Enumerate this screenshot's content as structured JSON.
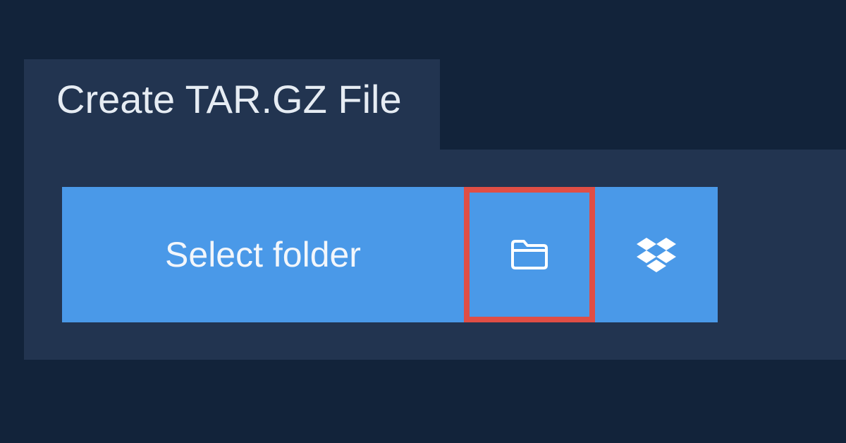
{
  "colors": {
    "page_background": "#12233a",
    "panel_background": "#223450",
    "button_background": "#4a99e8",
    "highlight_border": "#e04e45",
    "text": "#e6ecf3"
  },
  "panel": {
    "title": "Create TAR.GZ File"
  },
  "buttons": {
    "select_folder_label": "Select folder",
    "folder_icon": "folder-icon",
    "dropbox_icon": "dropbox-icon",
    "highlighted": "folder-button"
  }
}
